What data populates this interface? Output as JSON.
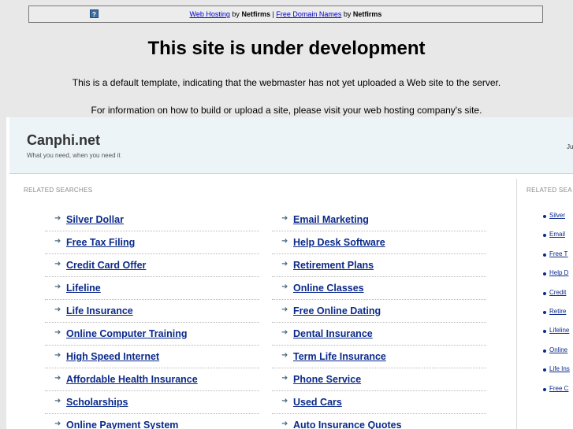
{
  "topbar": {
    "icon": "question-icon",
    "link1": "Web Hosting",
    "by1": "by",
    "brand1": "Netfirms",
    "sep": "|",
    "link2": "Free Domain Names",
    "by2": "by",
    "brand2": "Netfirms"
  },
  "dev": {
    "title": "This site is under development",
    "line1": "This is a default template, indicating that the webmaster has not yet uploaded a Web site to the server.",
    "line2": "For information on how to build or upload a site, please visit your web hosting company's site."
  },
  "header": {
    "site_name": "Canphi.net",
    "tagline": "What you need, when you need it",
    "date_stub": "Ju"
  },
  "related": {
    "label": "RELATED SEARCHES",
    "label_right": "RELATED SEA",
    "arrow": "➜",
    "col1": [
      "Silver Dollar",
      "Free Tax Filing",
      "Credit Card Offer",
      "Lifeline",
      "Life Insurance",
      "Online Computer Training",
      "High Speed Internet",
      "Affordable Health Insurance",
      "Scholarships",
      "Online Payment System"
    ],
    "col2": [
      "Email Marketing",
      "Help Desk Software",
      "Retirement Plans",
      "Online Classes",
      "Free Online Dating",
      "Dental Insurance",
      "Term Life Insurance",
      "Phone Service",
      "Used Cars",
      "Auto Insurance Quotes"
    ],
    "right": [
      "Silver",
      "Email",
      "Free T",
      "Help D",
      "Credit",
      "Retire",
      "Lifeline",
      "Online",
      "Life Ins",
      "Free C"
    ]
  }
}
